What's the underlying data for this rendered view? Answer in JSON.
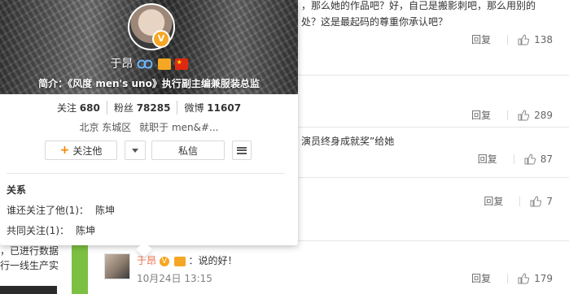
{
  "background_left": {
    "fragment_1": "，已进行数据",
    "fragment_2": "行一线生产实"
  },
  "comments": [
    {
      "snippet": "，那么她的作品吧？好，自己是搬影刺吧，那么用别的",
      "snippet2": "处？这是最起码的尊重你承认吧？",
      "reply": "回复",
      "likes": "138"
    },
    {
      "snippet": "",
      "reply": "回复",
      "likes": "289"
    },
    {
      "snippet": "演员终身成就奖”给她",
      "reply": "回复",
      "likes": "87"
    },
    {
      "snippet": "",
      "reply": "回复",
      "likes": "7"
    }
  ],
  "sub_comment": {
    "user": "于昂",
    "text": "：说的好！",
    "date": "10月24日 13:15",
    "reply": "回复",
    "likes": "179"
  },
  "profile_card": {
    "name": "于昂",
    "intro": "简介：《风度 men's uno》执行副主编兼服装总监",
    "stats": {
      "following_label": "关注",
      "following": "680",
      "fans_label": "粉丝",
      "fans": "78285",
      "weibo_label": "微博",
      "weibo": "11607"
    },
    "location": "北京 东城区",
    "work": "就职于 men&#...",
    "buttons": {
      "follow": "关注他",
      "message": "私信"
    },
    "relations": {
      "title": "关系",
      "who_follows_label": "谁还关注了他(1)：",
      "who_follows": "陈坤",
      "mutual_label": "共同关注(1)：",
      "mutual": "陈坤"
    }
  },
  "colors": {
    "accent_orange": "#ff8200",
    "username_orange": "#eb7350",
    "green_bar": "#7cc043",
    "verified_gold": "#f5a623"
  },
  "icons": {
    "like": "thumb-up-icon",
    "verified": "verified-v-icon",
    "menu": "menu-lines-icon",
    "dropdown": "caret-down-icon"
  }
}
